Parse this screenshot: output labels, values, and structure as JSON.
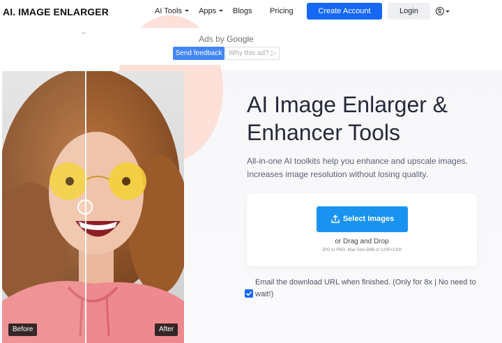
{
  "nav": {
    "logo": "AI. IMAGE ENLARGER",
    "ai_tools": "AI Tools",
    "apps": "Apps",
    "blogs": "Blogs",
    "pricing": "Pricing",
    "create_account": "Create Account",
    "login": "Login",
    "language_icon": "language-icon"
  },
  "ad": {
    "back_arrow": "←",
    "ads_by": "Ads by",
    "google": "Google",
    "send_feedback": "Send feedback",
    "why_this_ad": "Why this ad?",
    "why_icon": "▷"
  },
  "photo": {
    "before_label": "Before",
    "after_label": "After"
  },
  "hero": {
    "title_line1": "AI Image Enlarger &",
    "title_line2": "Enhancer Tools",
    "subtitle_line1": "All-in-one AI toolkits help you enhance and upscale images.",
    "subtitle_line2": "Increases image resolution without losing quality."
  },
  "upload": {
    "select_label": "Select Images",
    "drag_text": "or Drag and Drop",
    "limits_text": "JPG or PNG. Max Size 5MB or 1200×1200"
  },
  "email_option": {
    "text_line1": "Email the download URL when finished. (Only for 8x | No need to",
    "text_line2": "wait!)",
    "checked": true
  },
  "colors": {
    "primary": "#1668f5",
    "select_button": "#1a93f0",
    "blob": "#fde0d7"
  }
}
